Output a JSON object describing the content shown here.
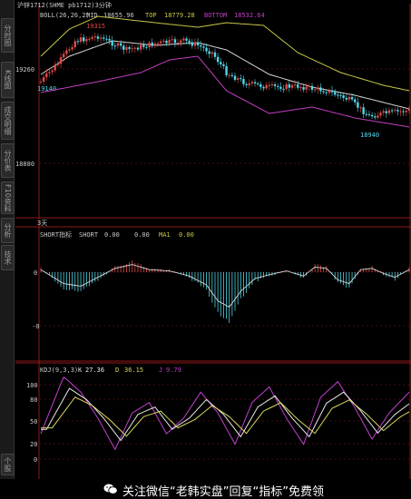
{
  "title": "沪锌1712(SHME pb1712)3分钟",
  "sidebar": {
    "tabs": [
      "分时图",
      "K线图",
      "成交明细",
      "分价表",
      "F10资料",
      "分析",
      "技术",
      "个股"
    ]
  },
  "boll_panel": {
    "header_label": "BOLL(26,26,2)",
    "mid_label": "MID",
    "mid_value": "18655.96",
    "top_label": "TOP",
    "top_value": "18779.28",
    "bottom_label": "BOTTOM",
    "bottom_value": "18532.64",
    "price_ticks": [
      "19260",
      "18880"
    ],
    "annotations": {
      "high": "19315",
      "low_left": "19140",
      "low_right": "18940"
    }
  },
  "short_panel": {
    "period_label": "3天",
    "header_label": "SHORT指标",
    "short_label": "SHORT",
    "short_value": "0.00",
    "ma_value": "0.00",
    "ma_label": "MA1",
    "ma1_value": "0.00",
    "ticks": [
      "0",
      "-0"
    ]
  },
  "kdj_panel": {
    "header_label": "KDJ(9,3,3)",
    "k_label": "K",
    "k_value": "27.36",
    "d_label": "D",
    "d_value": "36.15",
    "j_label": "J",
    "j_value": "9.79",
    "ticks": [
      "100",
      "80",
      "50",
      "20",
      "0"
    ]
  },
  "colors": {
    "up": "#e04848",
    "down": "#4fd8e8",
    "boll_upper": "#c8c84a",
    "boll_mid": "#d8d8d8",
    "boll_lower": "#c040c0",
    "k_line": "#e8e8e8",
    "d_line": "#d8d860",
    "j_line": "#c040d0",
    "grid": "#8b1a1a"
  },
  "watermark": {
    "text": "关注微信“老韩实盘”回复“指标”免费领",
    "icon": "wechat-icon"
  }
}
